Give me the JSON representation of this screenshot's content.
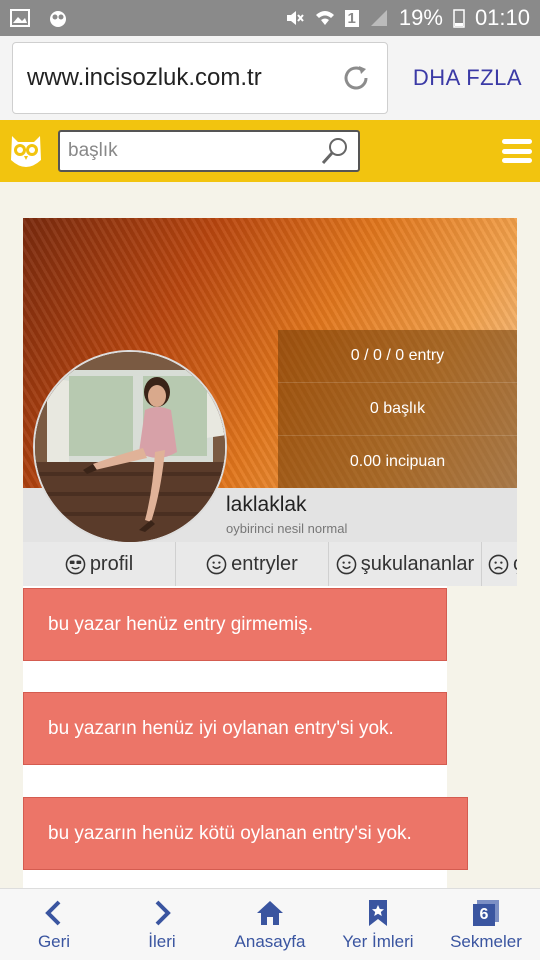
{
  "status_bar": {
    "battery": "19%",
    "time": "01:10",
    "sim_label": "1"
  },
  "browser": {
    "url": "www.incisozluk.com.tr",
    "side_button": "DHA FZLA"
  },
  "site": {
    "search_placeholder": "başlık"
  },
  "profile": {
    "stats": {
      "entries": "0 / 0 / 0 entry",
      "titles": "0 başlık",
      "points": "0.00 incipuan"
    },
    "username": "laklaklak",
    "user_type": "oybirinci nesil normal",
    "tabs": [
      {
        "label": "profil",
        "icon": "cool-face-icon"
      },
      {
        "label": "entryler",
        "icon": "smile-face-icon"
      },
      {
        "label": "şukulananlar",
        "icon": "smile-face-icon"
      },
      {
        "label": "ç",
        "icon": "frown-face-icon"
      }
    ]
  },
  "notices": [
    "bu yazar henüz entry girmemiş.",
    "bu yazarın henüz iyi oylanan entry'si yok.",
    "bu yazarın henüz kötü oylanan entry'si yok."
  ],
  "bottom_nav": {
    "items": [
      {
        "label": "Geri",
        "icon": "chevron-left-icon"
      },
      {
        "label": "İleri",
        "icon": "chevron-right-icon"
      },
      {
        "label": "Anasayfa",
        "icon": "home-icon"
      },
      {
        "label": "Yer İmleri",
        "icon": "bookmark-icon"
      },
      {
        "label": "Sekmeler",
        "icon": "tabs-icon",
        "badge": "6"
      }
    ]
  },
  "colors": {
    "header_yellow": "#f2c40f",
    "notice_red": "#ec7568",
    "nav_blue": "#3a55a0"
  }
}
